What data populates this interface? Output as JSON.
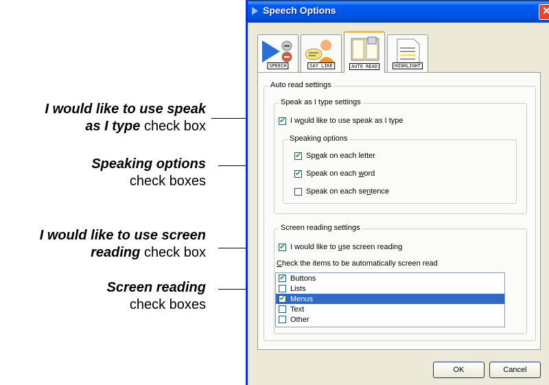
{
  "window": {
    "title": "Speech Options",
    "close_symbol": "✕",
    "accent_color": "#0054e3"
  },
  "tabs": [
    {
      "label": "SPEECH",
      "icon": "speaker-arrow-icon"
    },
    {
      "label": "SAY LIKE",
      "icon": "person-speech-icon"
    },
    {
      "label": "AUTO READ",
      "icon": "book-icon",
      "active": true
    },
    {
      "label": "HIGHLIGHT",
      "icon": "document-icon"
    }
  ],
  "auto_read": {
    "legend": "Auto read settings",
    "speak_as_type": {
      "legend": "Speak as I type settings",
      "checkbox_pre": "I w",
      "checkbox_key": "o",
      "checkbox_post": "uld like to use speak as I type",
      "checked": true,
      "speaking_options": {
        "legend": "Speaking options",
        "items": [
          {
            "pre": "Sp",
            "key": "e",
            "post": "ak on each letter",
            "checked": true
          },
          {
            "pre": "Speak on each ",
            "key": "w",
            "post": "ord",
            "checked": true
          },
          {
            "pre": "Speak on each se",
            "key": "n",
            "post": "tence",
            "checked": false
          }
        ]
      }
    },
    "screen_reading": {
      "legend": "Screen reading settings",
      "checkbox_pre": "I would like to ",
      "checkbox_key": "u",
      "checkbox_post": "se screen reading",
      "checked": true,
      "list_label_key": "C",
      "list_label_post": "heck the items to be automatically screen read",
      "items": [
        {
          "label": "Buttons",
          "checked": true,
          "selected": false
        },
        {
          "label": "Lists",
          "checked": false,
          "selected": false
        },
        {
          "label": "Menus",
          "checked": true,
          "selected": true
        },
        {
          "label": "Text",
          "checked": false,
          "selected": false
        },
        {
          "label": "Other",
          "checked": false,
          "selected": false
        }
      ]
    }
  },
  "buttons": {
    "ok": "OK",
    "cancel": "Cancel"
  },
  "callouts": {
    "c1_bold": "I would like to use speak as I type",
    "c1_rest": "check box",
    "c2_bold": "Speaking options",
    "c2_rest": "check boxes",
    "c3_bold": "I would like to use screen reading",
    "c3_rest": "check box",
    "c4_bold": "Screen reading",
    "c4_rest": "check boxes"
  }
}
